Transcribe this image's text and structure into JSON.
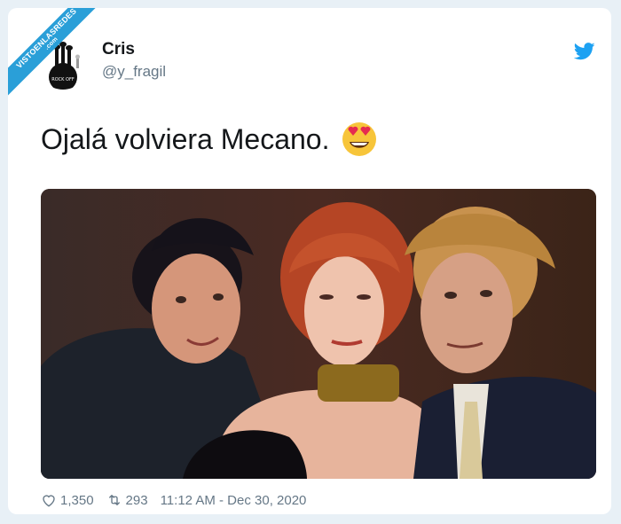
{
  "watermark": {
    "text": "VISTOENLASREDES",
    "sub": ".com"
  },
  "author": {
    "name": "Cris",
    "handle": "@y_fragil",
    "avatar_caption": "ROCK OFF"
  },
  "tweet": {
    "text": "Ojalá volviera Mecano.",
    "emoji": "smiling-face-with-heart-eyes"
  },
  "stats": {
    "likes": "1,350",
    "retweets": "293",
    "timestamp": "11:12 AM - Dec 30, 2020"
  },
  "colors": {
    "accent": "#1da1f2",
    "text": "#14171a",
    "muted": "#657786",
    "ribbon": "#2a9fd8"
  }
}
